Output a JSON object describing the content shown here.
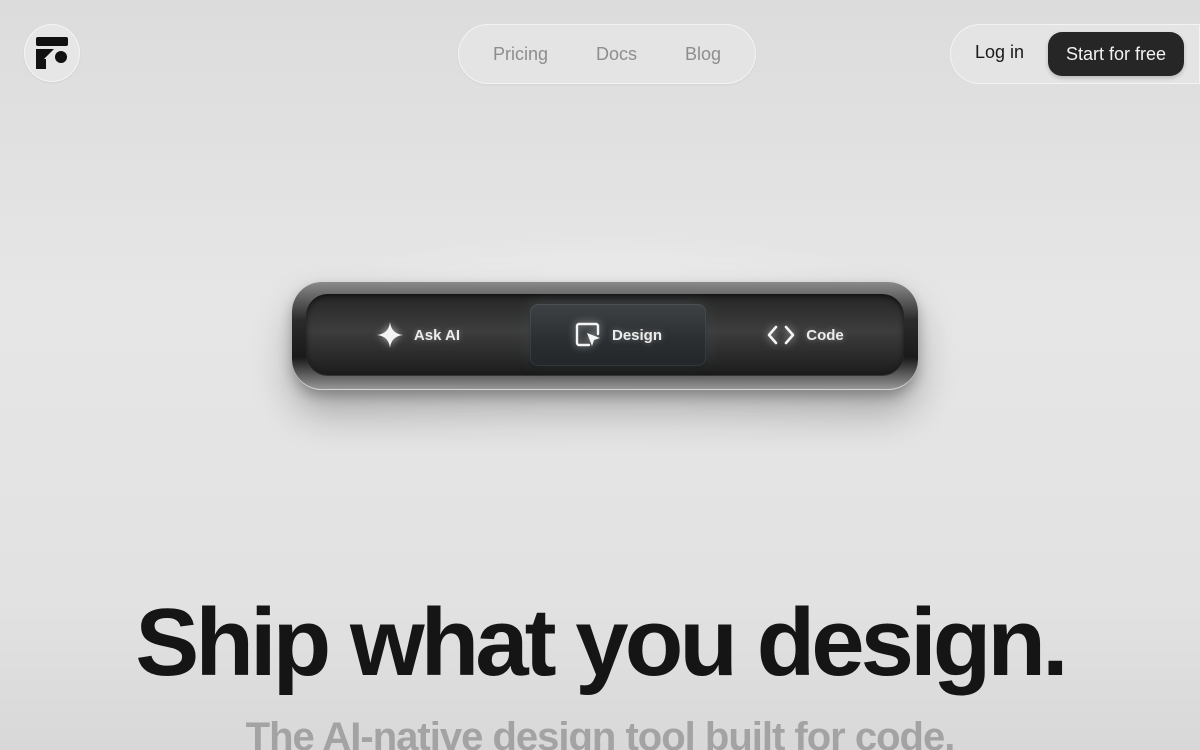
{
  "nav": {
    "links": [
      "Pricing",
      "Docs",
      "Blog"
    ]
  },
  "auth": {
    "login": "Log in",
    "start": "Start for free"
  },
  "switcher": {
    "segments": [
      {
        "label": "Ask AI",
        "icon": "sparkle-icon"
      },
      {
        "label": "Design",
        "icon": "cursor-frame-icon",
        "active": true
      },
      {
        "label": "Code",
        "icon": "code-brackets-icon"
      }
    ]
  },
  "hero": {
    "headline": "Ship what you design.",
    "subheadline": "The AI-native design tool built for code."
  },
  "colors": {
    "background": "#e2e2e2",
    "primary_button": "#262626",
    "nav_text": "#8d8d8d",
    "headline": "#151515",
    "subheadline": "#a3a3a3"
  }
}
